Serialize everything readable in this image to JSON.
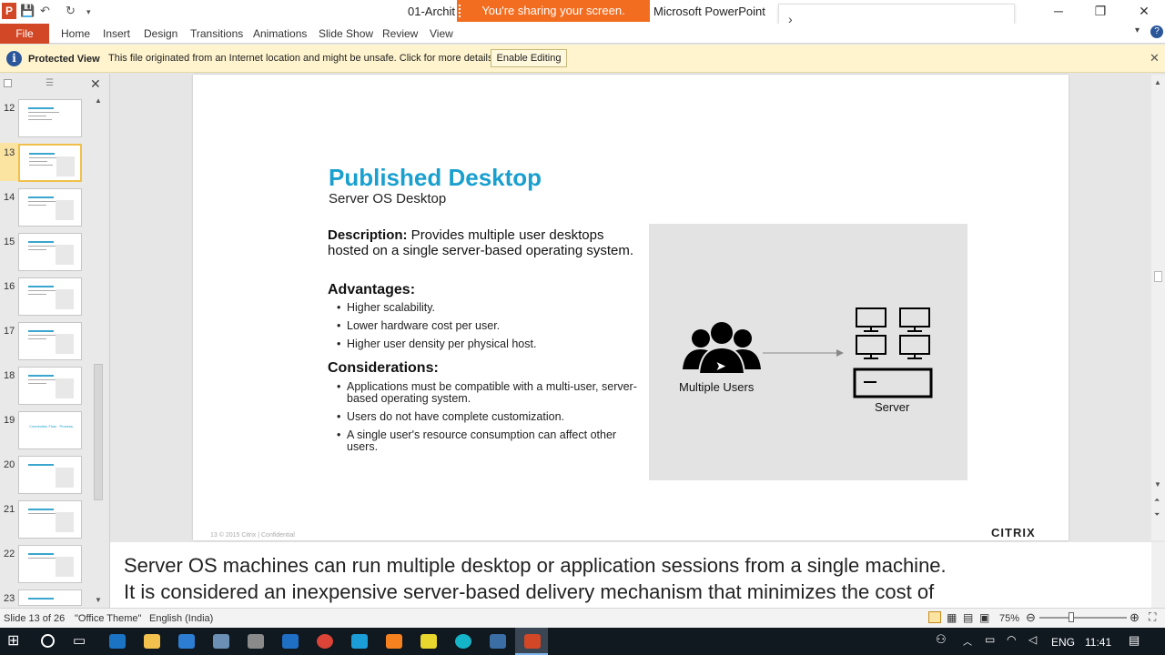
{
  "window": {
    "doc_title": "01-Archit",
    "app_name": "Microsoft PowerPoint",
    "share_banner": "You're sharing your screen.",
    "minimize_glyph": "─",
    "restore_glyph": "❐",
    "close_glyph": "✕"
  },
  "ribbon": {
    "file": "File",
    "tabs": [
      "Home",
      "Insert",
      "Design",
      "Transitions",
      "Animations",
      "Slide Show",
      "Review",
      "View"
    ],
    "help": "?"
  },
  "protected_view": {
    "title": "Protected View",
    "message": "This file originated from an Internet location and might be unsafe. Click for more details.",
    "button": "Enable Editing"
  },
  "thumbnails": {
    "numbers": [
      "12",
      "13",
      "14",
      "15",
      "16",
      "17",
      "18",
      "19",
      "20",
      "21",
      "22",
      "23"
    ],
    "selected": "13",
    "slide19_text": "Connection Flow · Process"
  },
  "slide": {
    "title": "Published Desktop",
    "subtitle": "Server OS Desktop",
    "description_label": "Description:",
    "description_text": " Provides multiple user desktops hosted on a single server-based operating system.",
    "advantages_heading": "Advantages:",
    "advantages": [
      "Higher scalability.",
      "Lower hardware cost per user.",
      "Higher user density per physical host."
    ],
    "considerations_heading": "Considerations:",
    "considerations": [
      "Applications must be compatible with a multi-user, server-based operating system.",
      "Users do not have complete customization.",
      "A single user's resource consumption can affect other users."
    ],
    "users_label": "Multiple Users",
    "server_label": "Server",
    "footer": "13   © 2015 Citrix | Confidential",
    "logo": "CITRIX"
  },
  "caption": {
    "line1": "Server OS machines can run multiple desktop or application sessions from a single machine.",
    "line2": "It is considered an inexpensive server-based delivery mechanism that minimizes the cost of"
  },
  "status": {
    "slide_info": "Slide 13 of 26",
    "theme": "\"Office Theme\"",
    "language": "English (India)",
    "zoom": "75%"
  },
  "taskbar": {
    "language": "ENG",
    "time": "11:41"
  },
  "colors": {
    "brand": "#d24726",
    "title_blue": "#1aa0cf",
    "share_orange": "#f36d21",
    "protected_bg": "#fff4ce"
  }
}
